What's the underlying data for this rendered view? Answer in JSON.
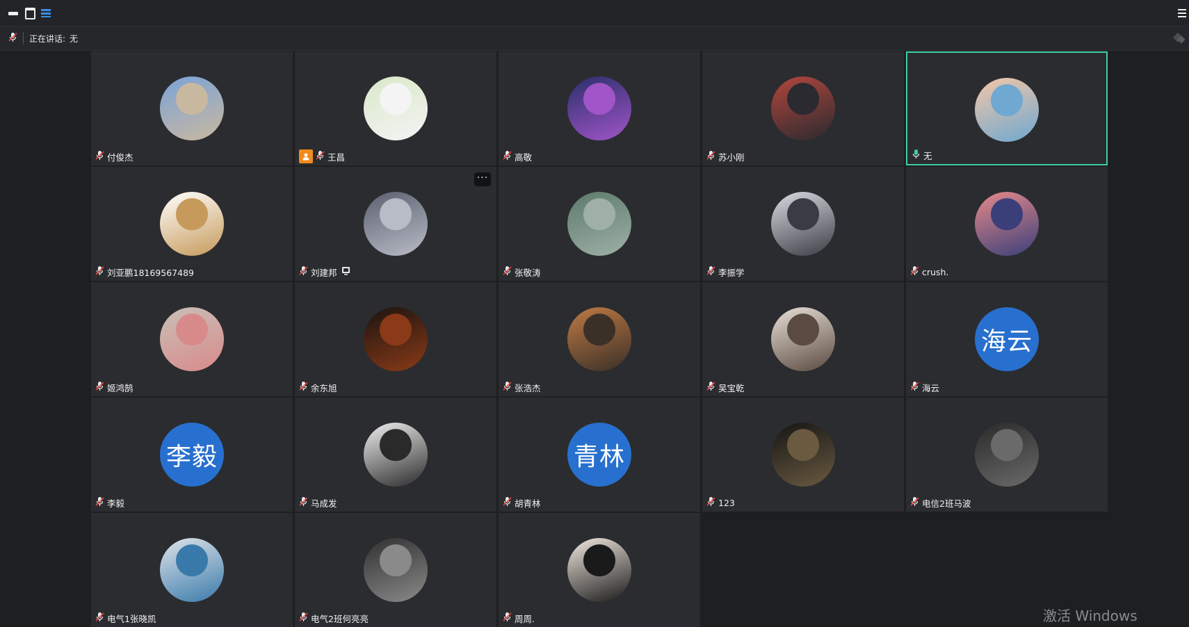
{
  "speaking": {
    "label": "正在讲话:",
    "value": "无"
  },
  "watermark": "激活 Windows",
  "colors": {
    "active_border": "#3fcf9f",
    "text_avatar": "#2870cf",
    "host_badge": "#f08a1a"
  },
  "participants": [
    {
      "name": "付俊杰",
      "avatar_icon": "photo-mountain-person",
      "mic": "muted"
    },
    {
      "name": "王昌",
      "avatar_icon": "photo-person-bicycle",
      "mic": "muted",
      "host": true
    },
    {
      "name": "高敬",
      "avatar_icon": "photo-highway-night",
      "mic": "muted"
    },
    {
      "name": "苏小刚",
      "avatar_icon": "photo-person-indoor",
      "mic": "muted"
    },
    {
      "name": "无",
      "avatar_icon": "photo-flower-bouquet",
      "mic": "active",
      "active": true
    },
    {
      "name": "刘亚鹏18169567489",
      "avatar_icon": "photo-bear-figure",
      "mic": "muted"
    },
    {
      "name": "刘建邦",
      "avatar_icon": "photo-anime-sketch",
      "mic": "muted",
      "sharing": true,
      "more_menu": "···"
    },
    {
      "name": "张敬涛",
      "avatar_icon": "photo-person-hill",
      "mic": "muted"
    },
    {
      "name": "李振学",
      "avatar_icon": "photo-anime-dark-hair",
      "mic": "muted"
    },
    {
      "name": "crush.",
      "avatar_icon": "photo-stitch-cartoon",
      "mic": "muted"
    },
    {
      "name": "姬鸿鹄",
      "avatar_icon": "photo-white-cat",
      "mic": "muted"
    },
    {
      "name": "余东旭",
      "avatar_icon": "photo-dark-silhouette",
      "mic": "muted"
    },
    {
      "name": "张浩杰",
      "avatar_icon": "photo-anime-brown-hair",
      "mic": "muted"
    },
    {
      "name": "吴宝乾",
      "avatar_icon": "photo-anime-swordsman",
      "mic": "muted"
    },
    {
      "name": "海云",
      "avatar_text": "海云",
      "mic": "muted"
    },
    {
      "name": "李毅",
      "avatar_text": "李毅",
      "mic": "muted"
    },
    {
      "name": "马成发",
      "avatar_icon": "photo-sketch-man",
      "mic": "muted"
    },
    {
      "name": "胡青林",
      "avatar_text": "青林",
      "mic": "muted"
    },
    {
      "name": "123",
      "avatar_icon": "photo-dark-person",
      "mic": "muted"
    },
    {
      "name": "电信2班马波",
      "avatar_icon": "photo-masked-figure",
      "mic": "muted"
    },
    {
      "name": "电气1张晓凯",
      "avatar_icon": "photo-anime-boy",
      "mic": "muted"
    },
    {
      "name": "电气2班何亮亮",
      "avatar_icon": "photo-dark-glasses",
      "mic": "muted"
    },
    {
      "name": "周周.",
      "avatar_icon": "photo-woman-sunglasses",
      "mic": "muted"
    }
  ]
}
